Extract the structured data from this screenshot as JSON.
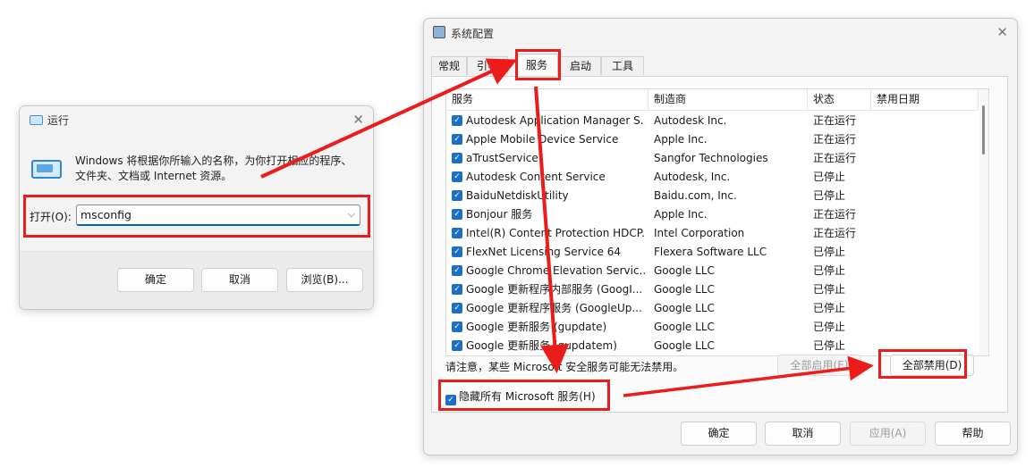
{
  "run_dialog": {
    "title": "运行",
    "description": "Windows 将根据你所输入的名称，为你打开相应的程序、文件夹、文档或 Internet 资源。",
    "open_label": "打开(O):",
    "input_value": "msconfig",
    "ok_label": "确定",
    "cancel_label": "取消",
    "browse_label": "浏览(B)..."
  },
  "msconfig": {
    "title": "系统配置",
    "tabs": [
      {
        "label": "常规"
      },
      {
        "label": "引导"
      },
      {
        "label": "服务"
      },
      {
        "label": "启动"
      },
      {
        "label": "工具"
      }
    ],
    "active_tab": "服务",
    "columns": {
      "service": "服务",
      "manufacturer": "制造商",
      "status": "状态",
      "disable_date": "禁用日期"
    },
    "rows": [
      {
        "service": "Autodesk Application Manager S...",
        "manufacturer": "Autodesk Inc.",
        "status": "正在运行",
        "checked": true
      },
      {
        "service": "Apple Mobile Device Service",
        "manufacturer": "Apple Inc.",
        "status": "正在运行",
        "checked": true
      },
      {
        "service": "aTrustService",
        "manufacturer": "Sangfor Technologies",
        "status": "正在运行",
        "checked": true
      },
      {
        "service": "Autodesk Content Service",
        "manufacturer": "Autodesk, Inc.",
        "status": "已停止",
        "checked": true
      },
      {
        "service": "BaiduNetdiskUtility",
        "manufacturer": "Baidu.com, Inc.",
        "status": "已停止",
        "checked": true
      },
      {
        "service": "Bonjour 服务",
        "manufacturer": "Apple Inc.",
        "status": "正在运行",
        "checked": true
      },
      {
        "service": "Intel(R) Content Protection HDCP...",
        "manufacturer": "Intel Corporation",
        "status": "正在运行",
        "checked": true
      },
      {
        "service": "FlexNet Licensing Service 64",
        "manufacturer": "Flexera Software LLC",
        "status": "已停止",
        "checked": true
      },
      {
        "service": "Google Chrome Elevation Servic...",
        "manufacturer": "Google LLC",
        "status": "已停止",
        "checked": true
      },
      {
        "service": "Google 更新程序内部服务 (GoogI...",
        "manufacturer": "Google LLC",
        "status": "已停止",
        "checked": true
      },
      {
        "service": "Google 更新程序服务 (GoogleUp...",
        "manufacturer": "Google LLC",
        "status": "已停止",
        "checked": true
      },
      {
        "service": "Google 更新服务 (gupdate)",
        "manufacturer": "Google LLC",
        "status": "已停止",
        "checked": true
      },
      {
        "service": "Google 更新服务 (gupdatem)",
        "manufacturer": "Google LLC",
        "status": "已停止",
        "checked": true
      }
    ],
    "note": "请注意，某些 Microsoft 安全服务可能无法禁用。",
    "enable_all_label": "全部启用(E)",
    "disable_all_label": "全部禁用(D)",
    "hide_ms_label": "隐藏所有 Microsoft 服务(H)",
    "hide_ms_checked": true,
    "ok_label": "确定",
    "cancel_label": "取消",
    "apply_label": "应用(A)",
    "help_label": "帮助"
  },
  "colors": {
    "highlight": "#ec1c1c",
    "checkbox": "#1b6fc4"
  }
}
